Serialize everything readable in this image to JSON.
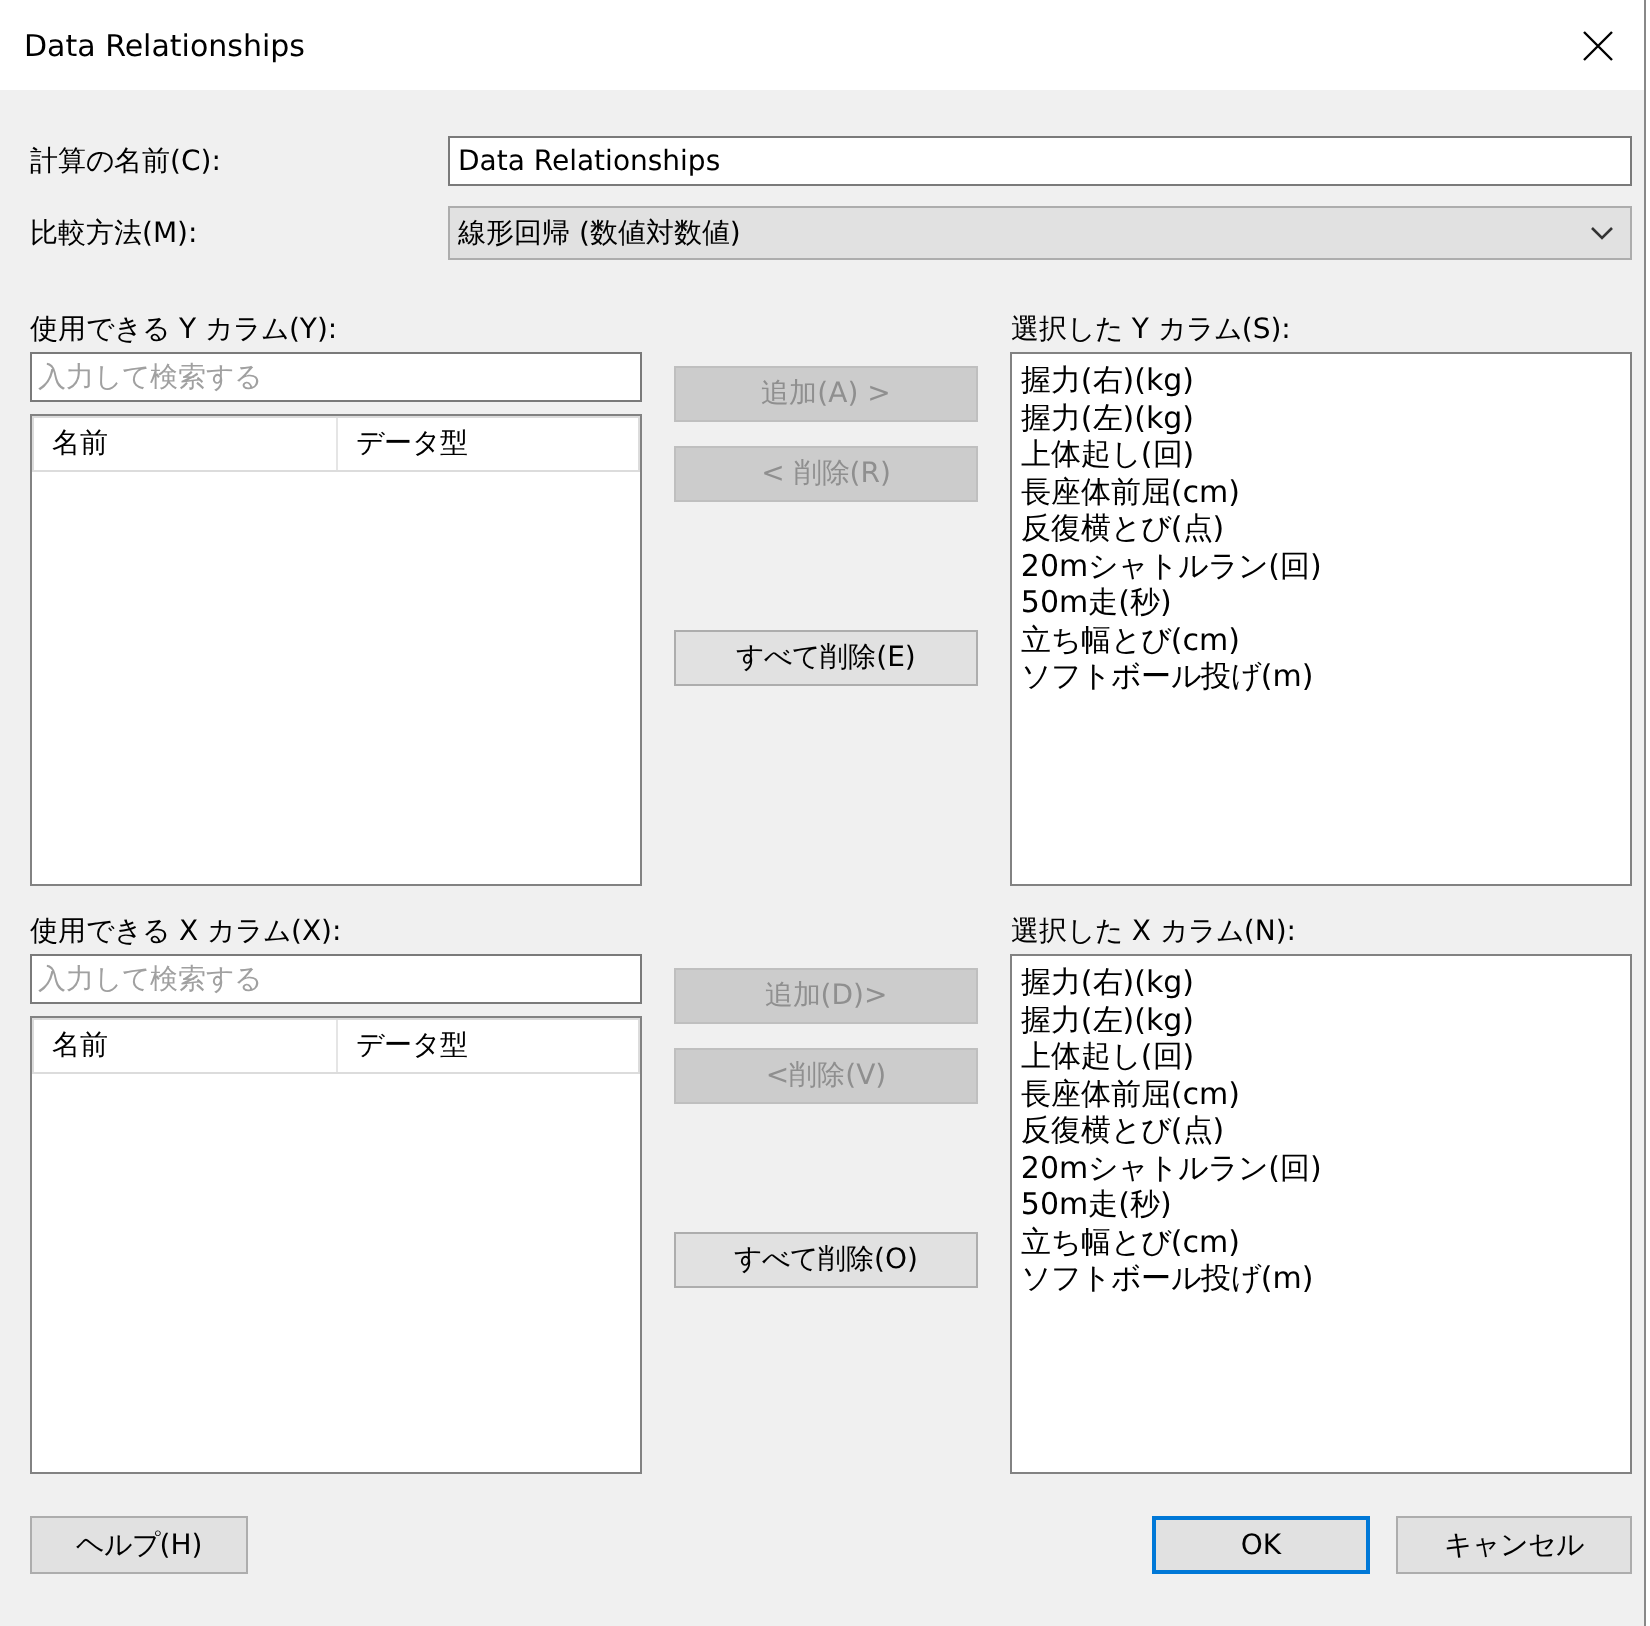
{
  "window": {
    "title": "Data Relationships"
  },
  "name_field": {
    "label": "計算の名前(C):",
    "value": "Data Relationships"
  },
  "method_combo": {
    "label": "比較方法(M):",
    "value": "線形回帰 (数値対数値)"
  },
  "sections": [
    {
      "available_label": "使用できる Y カラム(Y):",
      "search_placeholder": "入力して検索する",
      "columns": [
        "名前",
        "データ型"
      ],
      "buttons": [
        {
          "label": "追加(A) >",
          "disabled": true
        },
        {
          "label": "< 削除(R)",
          "disabled": true
        },
        {
          "label": "すべて削除(E)",
          "disabled": false
        }
      ],
      "selected_label": "選択した Y カラム(S):",
      "selected_items": [
        "握力(右)(kg)",
        "握力(左)(kg)",
        "上体起し(回)",
        "長座体前屈(cm)",
        "反復横とび(点)",
        "20mシャトルラン(回)",
        "50m走(秒)",
        "立ち幅とび(cm)",
        "ソフトボール投げ(m)"
      ]
    },
    {
      "available_label": "使用できる X カラム(X):",
      "search_placeholder": "入力して検索する",
      "columns": [
        "名前",
        "データ型"
      ],
      "buttons": [
        {
          "label": "追加(D)>",
          "disabled": true
        },
        {
          "label": "<削除(V)",
          "disabled": true
        },
        {
          "label": "すべて削除(O)",
          "disabled": false
        }
      ],
      "selected_label": "選択した X カラム(N):",
      "selected_items": [
        "握力(右)(kg)",
        "握力(左)(kg)",
        "上体起し(回)",
        "長座体前屈(cm)",
        "反復横とび(点)",
        "20mシャトルラン(回)",
        "50m走(秒)",
        "立ち幅とび(cm)",
        "ソフトボール投げ(m)"
      ]
    }
  ],
  "footer_buttons": [
    {
      "label": "ヘルプ(H)",
      "default": false
    },
    {
      "label": "OK",
      "default": true
    },
    {
      "label": "キャンセル",
      "default": false
    }
  ]
}
